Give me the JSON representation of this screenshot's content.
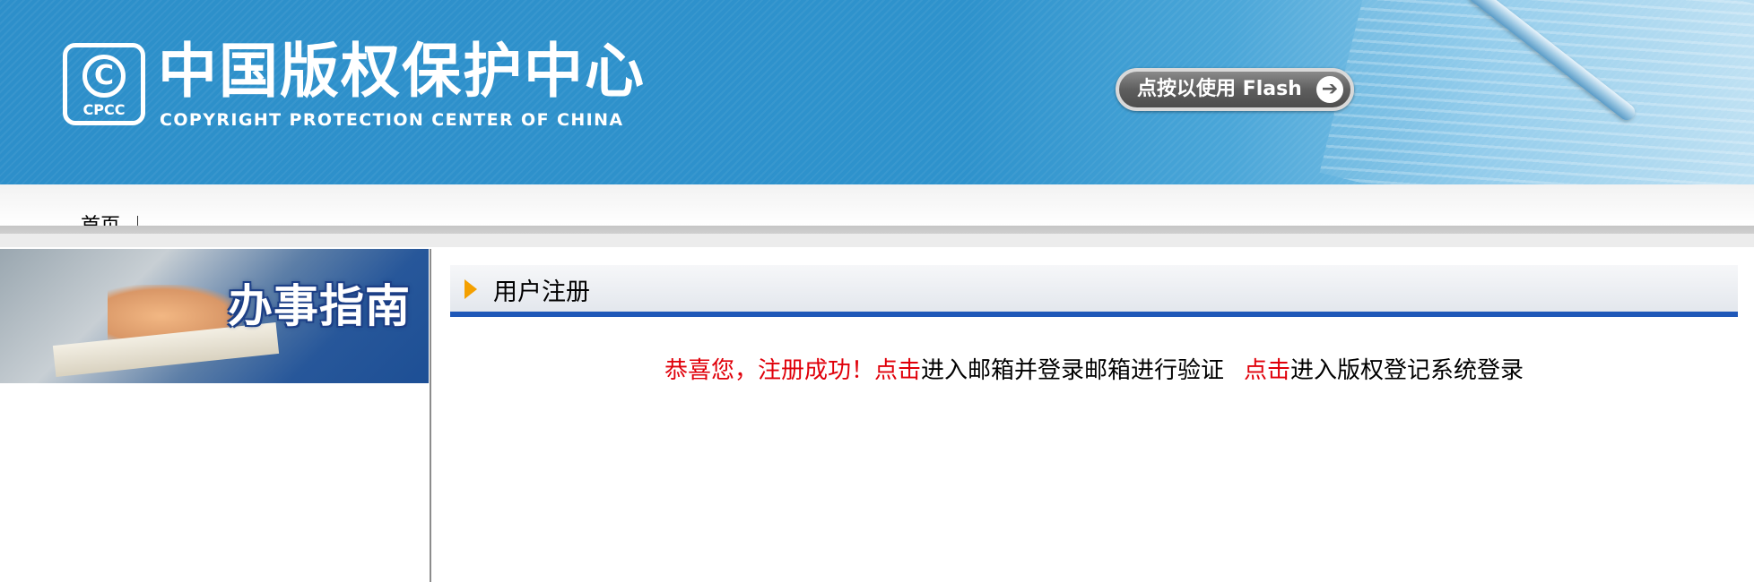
{
  "header": {
    "logo_mark_text": "CPCC",
    "logo_cn": "中国版权保护中心",
    "logo_en": "COPYRIGHT PROTECTION CENTER OF CHINA",
    "flash_button_label": "点按以使用 Flash",
    "flash_button_icon": "arrow-right-circle-icon"
  },
  "nav": {
    "items": [
      {
        "label": "首页"
      }
    ],
    "separator": "|"
  },
  "sidebar": {
    "guide_banner_title": "办事指南"
  },
  "main": {
    "section_title": "用户注册",
    "message": {
      "success_text": "恭喜您，注册成功！",
      "link1_label": "点击",
      "after_link1": "进入邮箱并登录邮箱进行验证",
      "link2_label": "点击",
      "after_link2": "进入版权登记系统登录"
    }
  },
  "colors": {
    "banner_blue": "#2e92cc",
    "accent_red": "#e0000a",
    "section_rule_blue": "#1f58b8",
    "bullet_orange": "#f4a000"
  }
}
